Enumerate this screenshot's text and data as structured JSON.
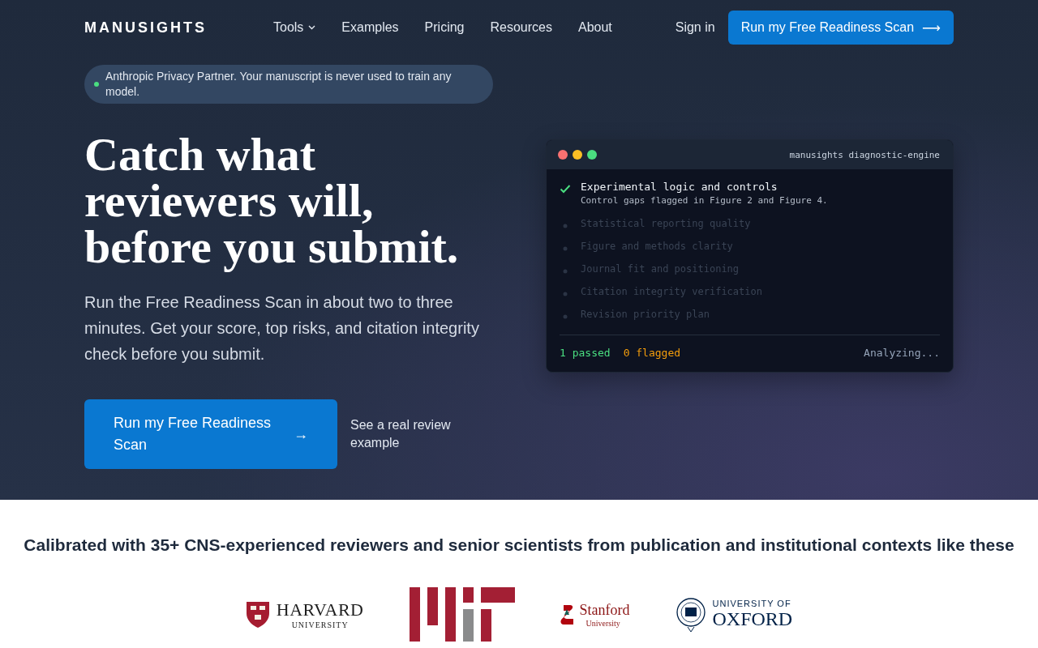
{
  "nav": {
    "logo": "MANUSIGHTS",
    "links": [
      {
        "label": "Tools",
        "dropdown": true
      },
      {
        "label": "Examples",
        "dropdown": false
      },
      {
        "label": "Pricing",
        "dropdown": false
      },
      {
        "label": "Resources",
        "dropdown": false
      },
      {
        "label": "About",
        "dropdown": false
      }
    ],
    "sign_in": "Sign in",
    "cta": "Run my Free Readiness Scan",
    "cta_arrow": "⟶"
  },
  "hero": {
    "badge": "Anthropic Privacy Partner. Your manuscript is never used to train any model.",
    "heading": "Catch what reviewers will, before you submit.",
    "lead": "Run the Free Readiness Scan in about two to three minutes. Get your score, top risks, and citation integrity check before you submit.",
    "cta": "Run my Free Readiness Scan",
    "cta_arrow": "→",
    "secondary_link": "See a real review example"
  },
  "terminal": {
    "title": "manusights diagnostic-engine",
    "checks": [
      {
        "label": "Experimental logic and controls",
        "detail": "Control gaps flagged in Figure 2 and Figure 4.",
        "checked": true
      },
      {
        "label": "Statistical reporting quality",
        "checked": false
      },
      {
        "label": "Figure and methods clarity",
        "checked": false
      },
      {
        "label": "Journal fit and positioning",
        "checked": false
      },
      {
        "label": "Citation integrity verification",
        "checked": false
      },
      {
        "label": "Revision priority plan",
        "checked": false
      }
    ],
    "passed": "1 passed",
    "flagged": "0 flagged",
    "status": "Analyzing..."
  },
  "trust": {
    "heading": "Calibrated with 35+ CNS-experienced reviewers and senior scientists from publication and institutional contexts like these",
    "logos": [
      {
        "kind": "shield",
        "name": "HARVARD",
        "sub": "UNIVERSITY"
      },
      {
        "kind": "bars"
      },
      {
        "kind": "tree",
        "name": "Stanford",
        "sub": "University"
      },
      {
        "kind": "seal",
        "top": "UNIVERSITY OF",
        "name": "OXFORD"
      }
    ]
  }
}
